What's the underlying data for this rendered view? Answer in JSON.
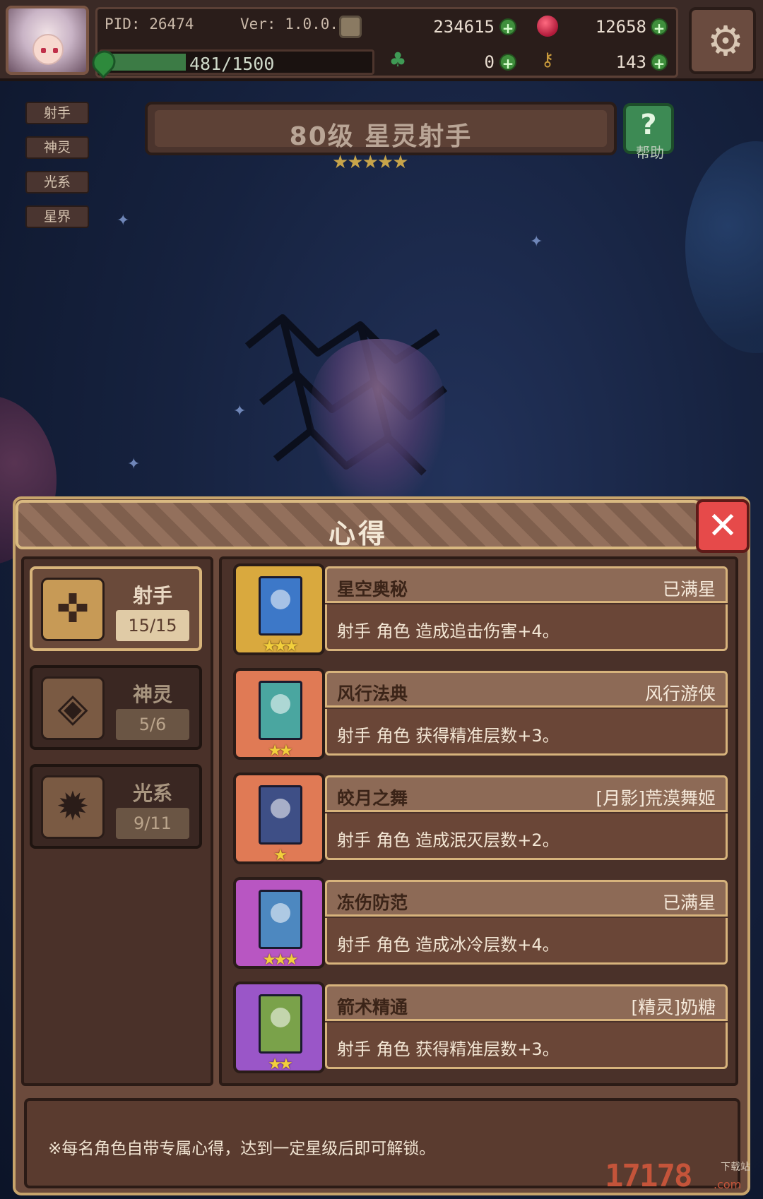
{
  "hud": {
    "pid": "PID: 26474",
    "version": "Ver: 1.0.0.0",
    "gold": "234615",
    "gems": "12658",
    "energy": "481/1500",
    "energy_fraction": 0.32,
    "clover": "0",
    "keys": "143"
  },
  "tags": [
    "射手",
    "神灵",
    "光系",
    "星界"
  ],
  "hero": {
    "title": "80级  星灵射手",
    "stars": "★★★★★",
    "help_label": "帮助"
  },
  "dialog": {
    "title": "心得",
    "close": "✕",
    "categories": [
      {
        "name": "射手",
        "count": "15/15",
        "icon": "crossbow-icon"
      },
      {
        "name": "神灵",
        "count": "5/6",
        "icon": "eye-icon"
      },
      {
        "name": "光系",
        "count": "9/11",
        "icon": "sun-icon"
      }
    ],
    "items": [
      {
        "name": "星空奥秘",
        "status": "已满星",
        "desc": "射手 角色 造成追击伤害+4。",
        "stars": "★★★",
        "frame_color": "#d9a93e",
        "book_color": "#3d78c8"
      },
      {
        "name": "风行法典",
        "status": "风行游侠",
        "desc": "射手 角色 获得精准层数+3。",
        "stars": "★★",
        "frame_color": "#e07a55",
        "book_color": "#4aa6a0"
      },
      {
        "name": "皎月之舞",
        "status": "[月影]荒漠舞姬",
        "desc": "射手 角色 造成泯灭层数+2。",
        "stars": "★",
        "frame_color": "#e07a55",
        "book_color": "#3e4f86"
      },
      {
        "name": "冻伤防范",
        "status": "已满星",
        "desc": "射手 角色 造成冰冷层数+4。",
        "stars": "★★★",
        "frame_color": "#b856c2",
        "book_color": "#4d88c0"
      },
      {
        "name": "箭术精通",
        "status": "[精灵]奶糖",
        "desc": "射手 角色 获得精准层数+3。",
        "stars": "★★",
        "frame_color": "#9a56c8",
        "book_color": "#7aa24a"
      }
    ],
    "footer_note": "※每名角色自带专属心得，达到一定星级后即可解锁。"
  },
  "watermark": {
    "main": "17178",
    "sub": "下载站",
    "com": ".com"
  }
}
